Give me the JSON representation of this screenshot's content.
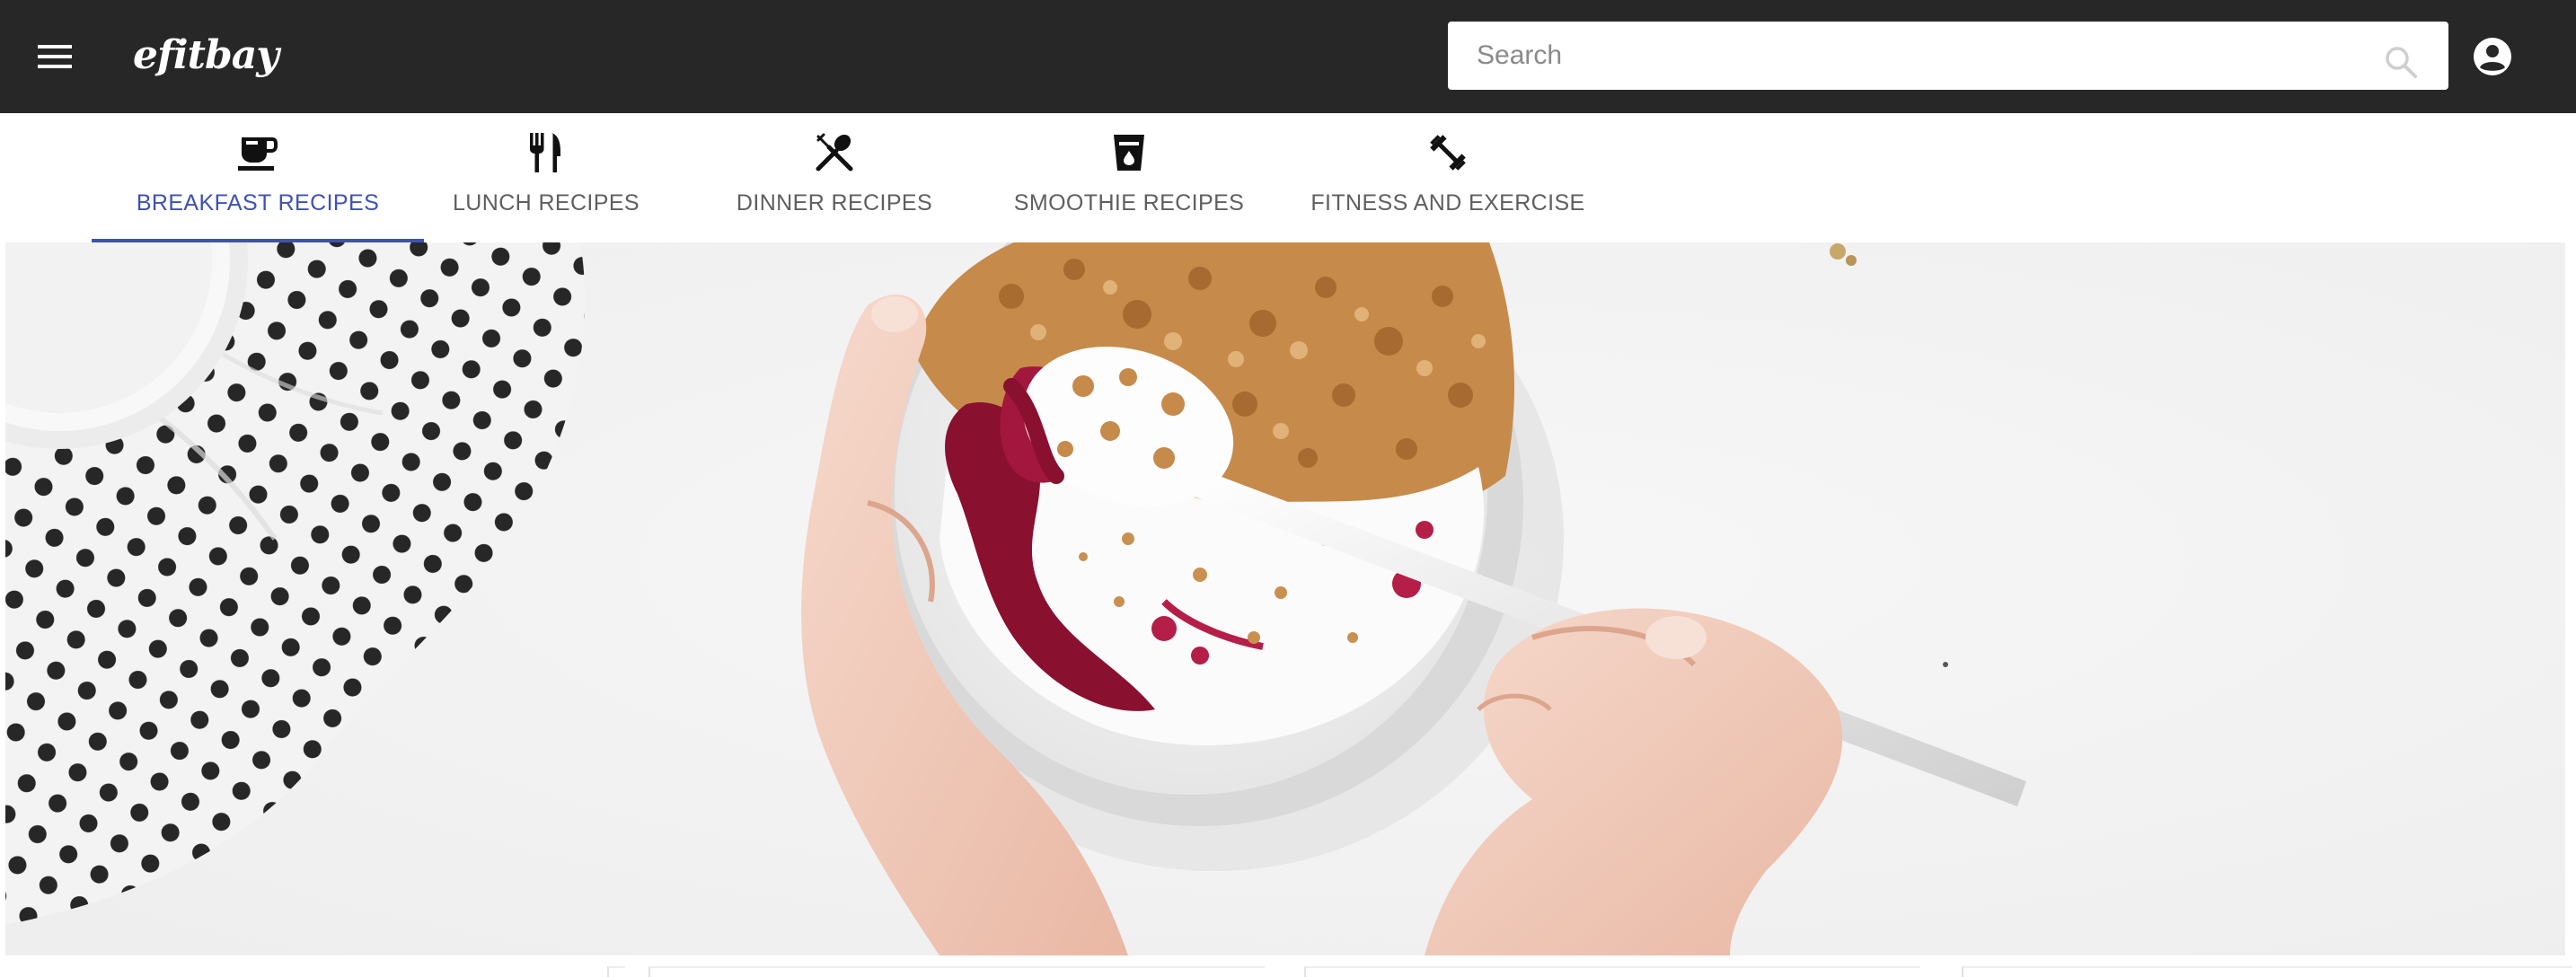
{
  "header": {
    "logo_text": "efitbay",
    "menu_icon": "hamburger-menu-icon",
    "search": {
      "placeholder": "Search",
      "value": "",
      "icon": "search-icon"
    },
    "account_icon": "account-circle-icon",
    "background_color": "#272727"
  },
  "tabs": [
    {
      "label": "BREAKFAST RECIPES",
      "icon": "coffee-cup-icon",
      "active": true
    },
    {
      "label": "LUNCH RECIPES",
      "icon": "fork-knife-icon",
      "active": false
    },
    {
      "label": "DINNER RECIPES",
      "icon": "crossed-utensils-icon",
      "active": false
    },
    {
      "label": "SMOOTHIE RECIPES",
      "icon": "drink-cup-icon",
      "active": false
    },
    {
      "label": "FITNESS AND EXERCISE",
      "icon": "dumbbell-icon",
      "active": false
    }
  ],
  "colors": {
    "accent": "#3f51b5",
    "tab_text": "#5f5f5f"
  },
  "hero": {
    "image": "hands-eating-yogurt-granola-bowl-photo"
  }
}
